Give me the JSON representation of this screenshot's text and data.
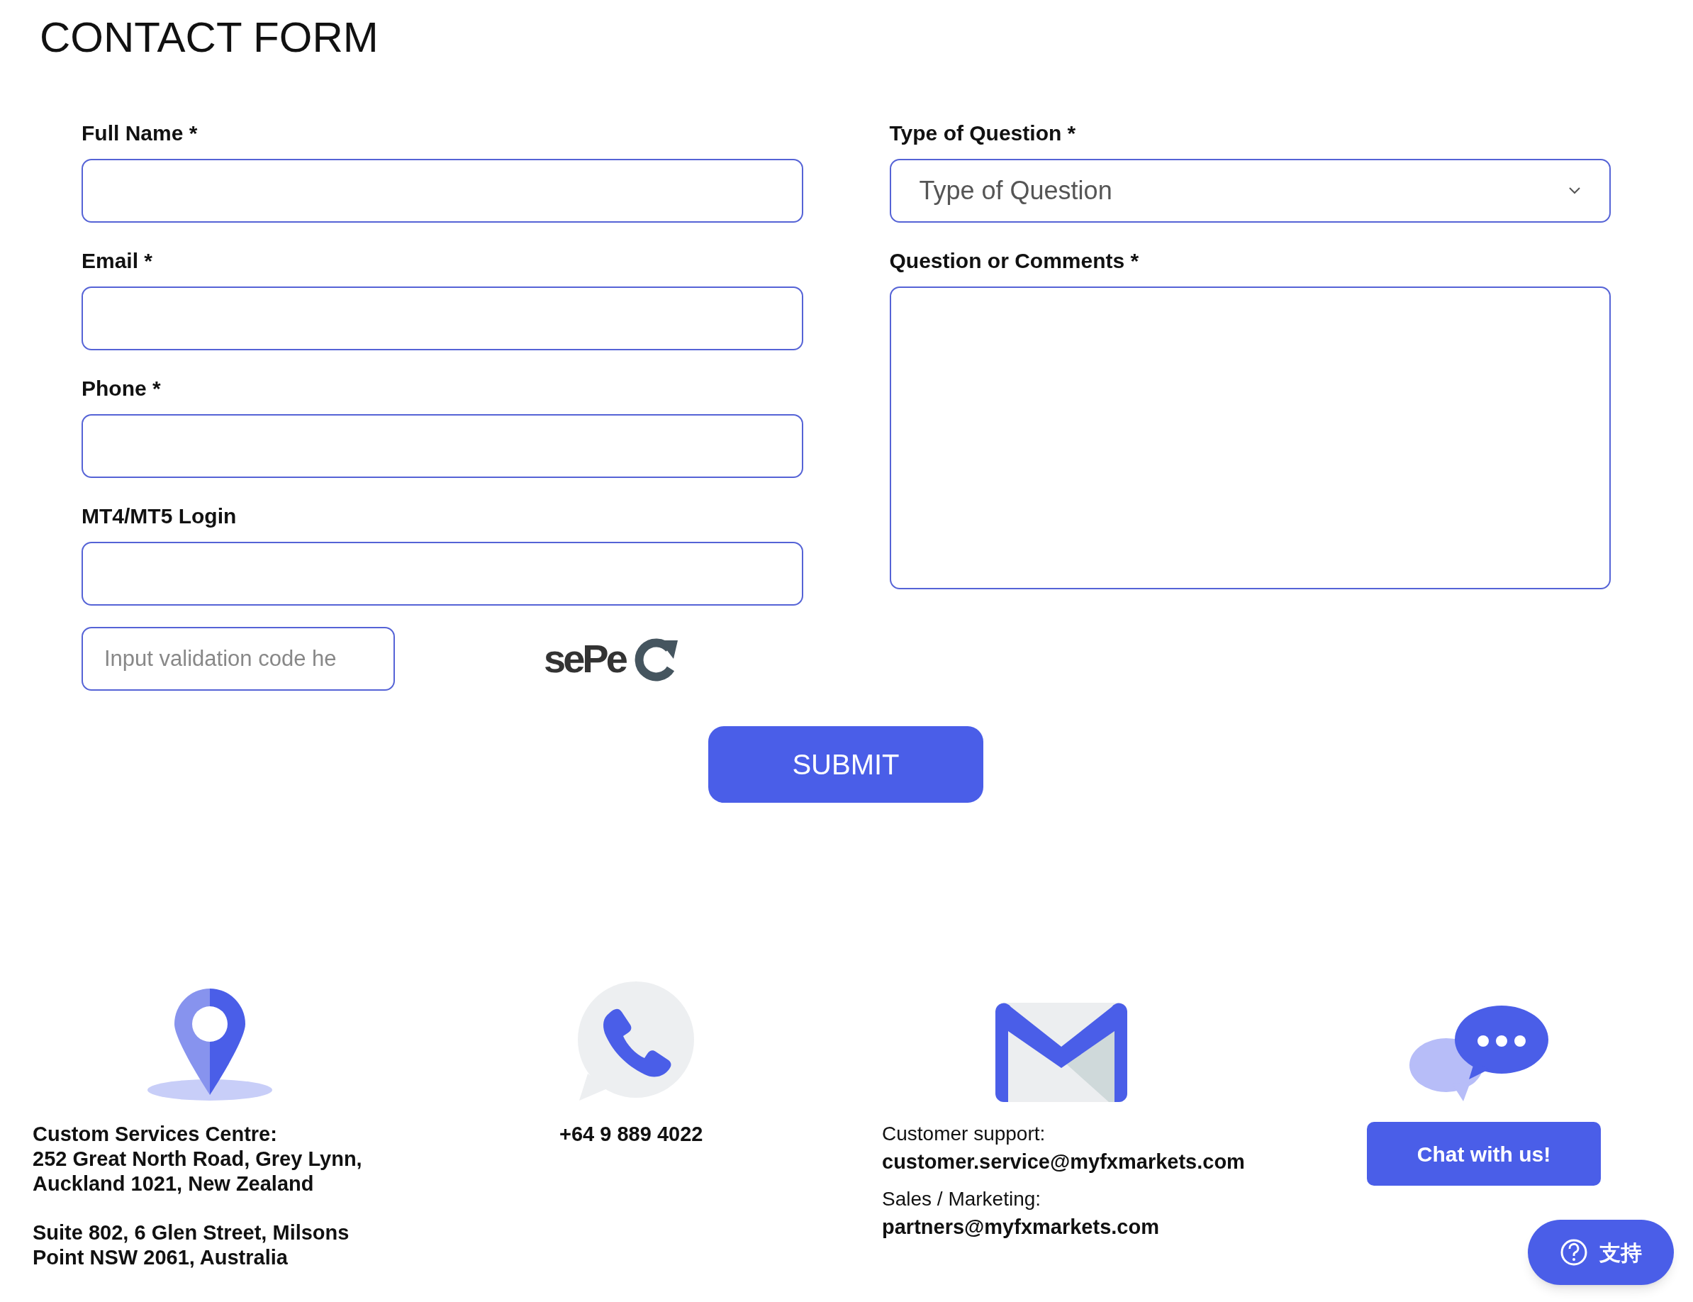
{
  "title": "CONTACT FORM",
  "left_fields": [
    {
      "label": "Full Name *",
      "kind": "input"
    },
    {
      "label": "Email *",
      "kind": "input"
    },
    {
      "label": "Phone *",
      "kind": "input"
    },
    {
      "label": "MT4/MT5 Login",
      "kind": "input"
    }
  ],
  "right_fields": [
    {
      "label": "Type of Question *",
      "kind": "select",
      "value": "Type of Question"
    },
    {
      "label": "Question or Comments *",
      "kind": "textarea"
    }
  ],
  "captcha": {
    "placeholder": "Input validation code he",
    "code": "sePe"
  },
  "submit": "SUBMIT",
  "contacts": [
    {
      "kind": "location",
      "lines": [
        "Custom Services Centre:\n252 Great North Road, Grey Lynn,\nAuckland 1021, New Zealand",
        "Suite 802, 6 Glen Street, Milsons\nPoint NSW 2061, Australia"
      ]
    },
    {
      "kind": "phone",
      "lines": [
        "+64 9 889 4022"
      ]
    },
    {
      "kind": "email",
      "groups": [
        {
          "label": "Customer support:",
          "value": "customer.service@myfxmarkets.com"
        },
        {
          "label": "Sales / Marketing:",
          "value": "partners@myfxmarkets.com"
        }
      ]
    },
    {
      "kind": "chat",
      "button": "Chat with us!"
    }
  ],
  "support_button": "支持"
}
